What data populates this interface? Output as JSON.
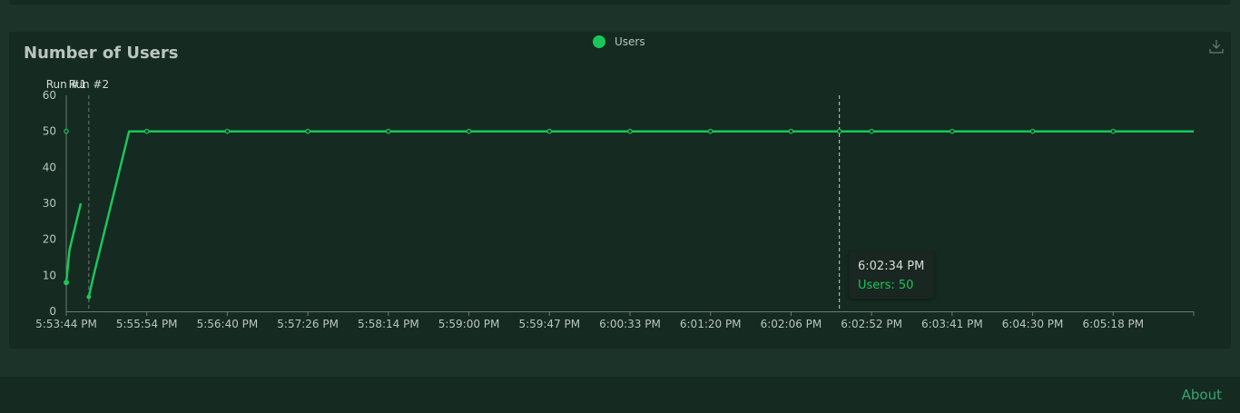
{
  "chart": {
    "title": "Number of Users",
    "legend_label": "Users",
    "series_color": "#18c75b",
    "download_icon": "download-icon"
  },
  "chart_data": {
    "type": "line",
    "title": "Number of Users",
    "ylim": [
      0,
      60
    ],
    "y_ticks": [
      0,
      10,
      20,
      30,
      40,
      50,
      60
    ],
    "x_tick_labels": [
      "5:53:44 PM",
      "5:55:54 PM",
      "5:56:40 PM",
      "5:57:26 PM",
      "5:58:14 PM",
      "5:59:00 PM",
      "5:59:47 PM",
      "6:00:33 PM",
      "6:01:20 PM",
      "6:02:06 PM",
      "6:02:52 PM",
      "6:03:41 PM",
      "6:04:30 PM",
      "6:05:18 PM"
    ],
    "x_tick_index": [
      0,
      5,
      10,
      15,
      20,
      25,
      30,
      35,
      40,
      45,
      50,
      55,
      60,
      65
    ],
    "x_max_index": 70,
    "markers": [
      {
        "label": "Run #1",
        "index": 0
      },
      {
        "label": "Run #2",
        "index": 1.4
      }
    ],
    "series": [
      {
        "name": "Users",
        "segments": [
          [
            [
              0,
              8
            ],
            [
              0.2,
              17
            ],
            [
              0.9,
              30
            ]
          ],
          [
            [
              1.4,
              4
            ],
            [
              1.7,
              10
            ],
            [
              3.9,
              50
            ],
            [
              70,
              50
            ]
          ]
        ],
        "point_index": [
          0,
          5,
          10,
          15,
          20,
          25,
          30,
          35,
          40,
          45,
          48,
          50,
          55,
          60,
          65
        ]
      }
    ],
    "grid": false,
    "legend_position": "top-center",
    "tooltip": {
      "time": "6:02:34 PM",
      "text": "Users: 50",
      "index": 48
    }
  },
  "footer": {
    "about_label": "About"
  }
}
